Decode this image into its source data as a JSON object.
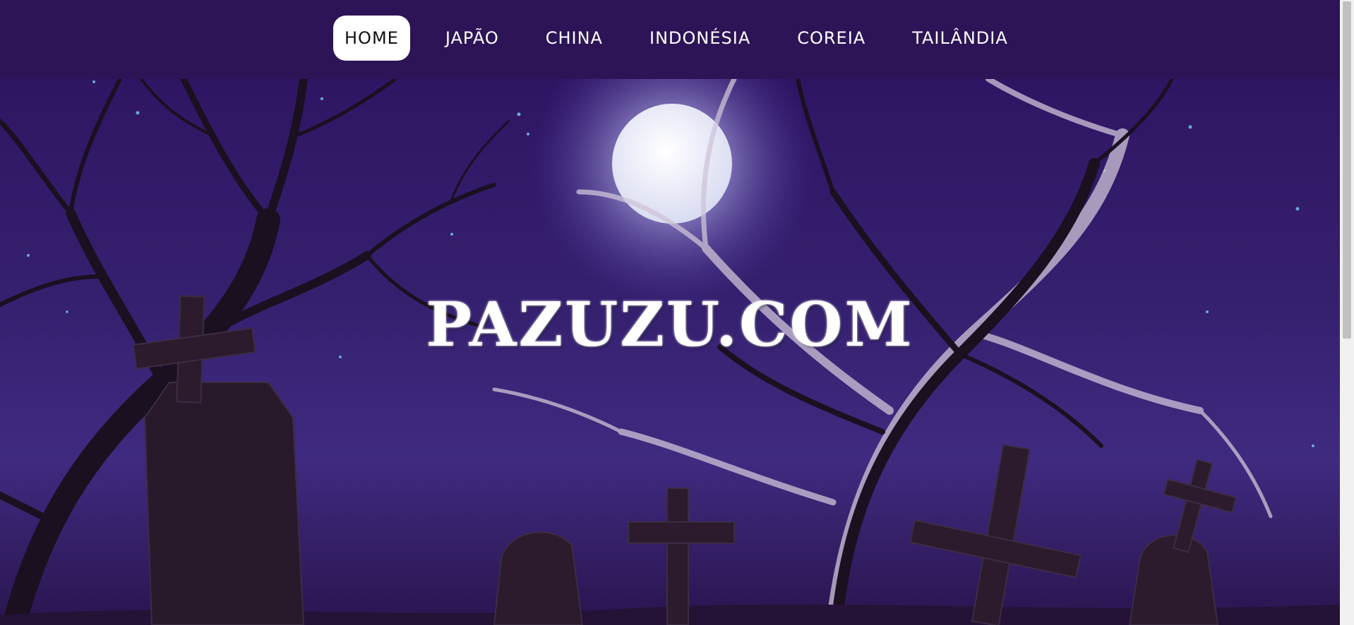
{
  "nav": {
    "items": [
      {
        "label": "HOME",
        "active": true
      },
      {
        "label": "JAPÃO",
        "active": false
      },
      {
        "label": "CHINA",
        "active": false
      },
      {
        "label": "INDONÉSIA",
        "active": false
      },
      {
        "label": "COREIA",
        "active": false
      },
      {
        "label": "TAILÂNDIA",
        "active": false
      }
    ]
  },
  "hero": {
    "title": "PAZUZU.COM",
    "background": "haunted-graveyard-illustration"
  },
  "colors": {
    "nav_background": "#2d1456",
    "sky": "#35206f",
    "active_tab": "#ffffff"
  }
}
